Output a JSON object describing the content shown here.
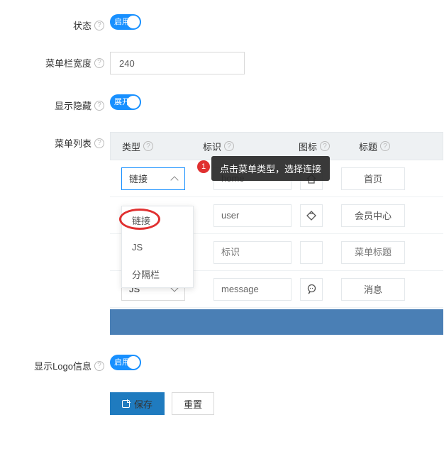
{
  "rows": {
    "status": {
      "label": "状态",
      "toggle_text": "启用"
    },
    "width": {
      "label": "菜单栏宽度",
      "value": "240"
    },
    "show": {
      "label": "显示隐藏",
      "toggle_text": "展开"
    },
    "list": {
      "label": "菜单列表"
    },
    "logo": {
      "label": "显示Logo信息",
      "toggle_text": "启用"
    }
  },
  "columns": {
    "type": "类型",
    "mark": "标识",
    "icon": "图标",
    "title": "标题"
  },
  "table": [
    {
      "type": "链接",
      "mark": "home",
      "icon": "home",
      "title": "首页"
    },
    {
      "type": "",
      "mark": "user",
      "icon": "diamond",
      "title": "会员中心"
    },
    {
      "type": "",
      "mark_placeholder": "标识",
      "icon": "",
      "title_placeholder": "菜单标题"
    },
    {
      "type": "JS",
      "mark": "message",
      "icon": "message",
      "title": "消息"
    }
  ],
  "dropdown": {
    "options": [
      "链接",
      "JS",
      "分隔栏"
    ]
  },
  "callout": {
    "num": "1",
    "text": "点击菜单类型，选择连接"
  },
  "buttons": {
    "save": "保存",
    "reset": "重置"
  }
}
